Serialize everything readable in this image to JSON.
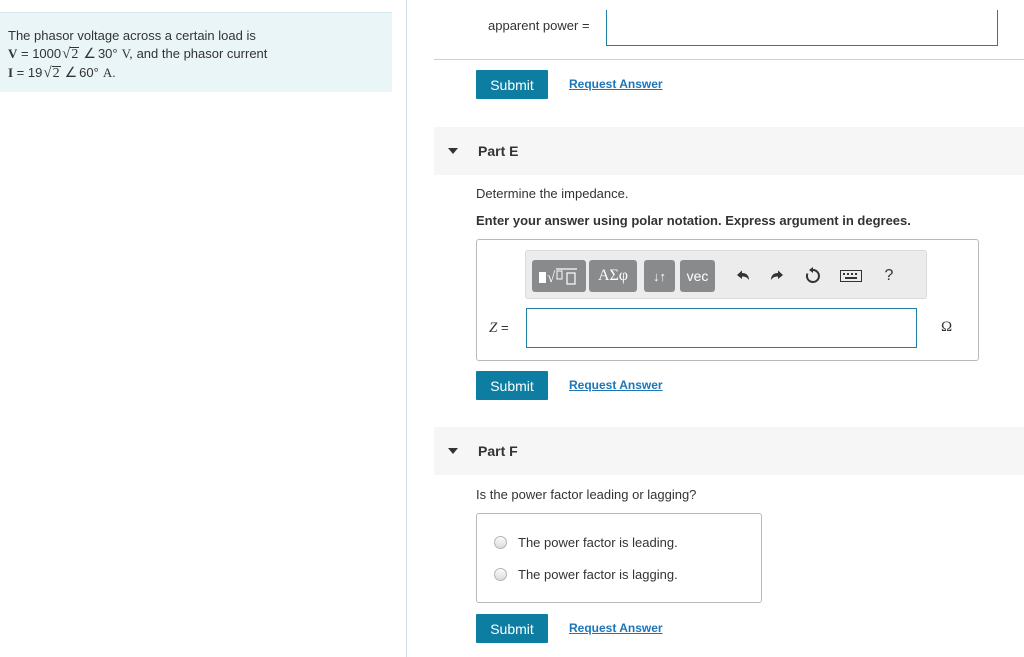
{
  "problem": {
    "line1": "The phasor voltage across a certain load is",
    "v_var": "V",
    "v_eq": " = 1000",
    "v_radicand": "2",
    "v_angle_sym": "∠",
    "v_angle": "30°",
    "v_unit": "V,",
    "v_tail": "and the phasor current",
    "i_var": "I",
    "i_eq": " = 19",
    "i_radicand": "2",
    "i_angle_sym": "∠",
    "i_angle": "60°",
    "i_unit": "A."
  },
  "previous_part": {
    "label": "apparent power =",
    "input_value": "",
    "submit": "Submit",
    "request": "Request Answer"
  },
  "part_e": {
    "title": "Part E",
    "question": "Determine the impedance.",
    "instruction": "Enter your answer using polar notation. Express argument in degrees.",
    "toolbar": {
      "templates_label": "√▯",
      "greek_label": "ΑΣφ",
      "arrows_label": "↓↑",
      "vec_label": "vec",
      "help_label": "?"
    },
    "var_label": "Z",
    "equals": " =",
    "input_value": "",
    "unit": "Ω",
    "submit": "Submit",
    "request": "Request Answer"
  },
  "part_f": {
    "title": "Part F",
    "question": "Is the power factor leading or lagging?",
    "options": [
      "The power factor is leading.",
      "The power factor is lagging."
    ],
    "submit": "Submit",
    "request": "Request Answer"
  },
  "colors": {
    "accent": "#0d7ea1",
    "link": "#1c76b8",
    "problem_bg": "#eaf5f7",
    "part_header_bg": "#f6f6f6"
  }
}
